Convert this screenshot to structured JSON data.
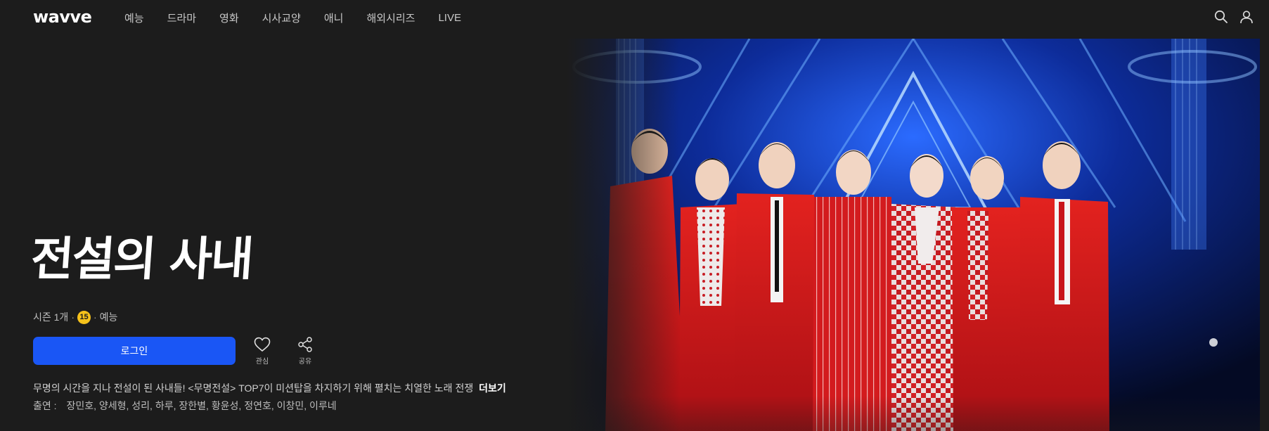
{
  "header": {
    "logo": "wavve",
    "nav": [
      "예능",
      "드라마",
      "영화",
      "시사교양",
      "애니",
      "해외시리즈",
      "LIVE"
    ],
    "icons": [
      "search-icon",
      "user-icon"
    ]
  },
  "show": {
    "title": "전설의 사내",
    "season": "시즌 1개",
    "age_rating": "15",
    "genre": "예능",
    "login_label": "로그인",
    "favorite_label": "관심",
    "share_label": "공유",
    "description": "무명의 시간을 지나 전설이 된 사내들! <무명전설> TOP7이 미션탑을 차지하기 위해 펼치는 치열한 노래 전쟁",
    "more_label": "더보기",
    "cast_label": "출연 :",
    "cast": "장민호, 양세형, 성리, 하루, 장한별, 황윤성, 정연호, 이창민, 이루네"
  },
  "colors": {
    "background": "#1c1c1c",
    "primary_button": "#1a56f5",
    "age_badge": "#f6c21b",
    "suit_red": "#d31a1c"
  }
}
